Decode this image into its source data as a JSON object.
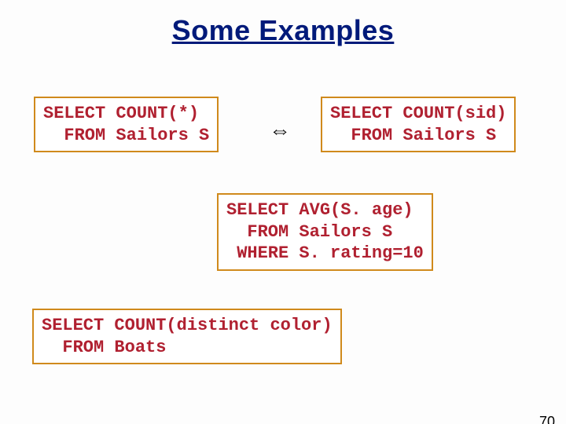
{
  "title": "Some Examples",
  "boxes": {
    "q1": "SELECT COUNT(*)\n  FROM Sailors S",
    "q2": "SELECT COUNT(sid)\n  FROM Sailors S",
    "q3": "SELECT AVG(S. age)\n  FROM Sailors S\n WHERE S. rating=10",
    "q4": "SELECT COUNT(distinct color)\n  FROM Boats"
  },
  "arrow": "⇔",
  "page_number": "70"
}
